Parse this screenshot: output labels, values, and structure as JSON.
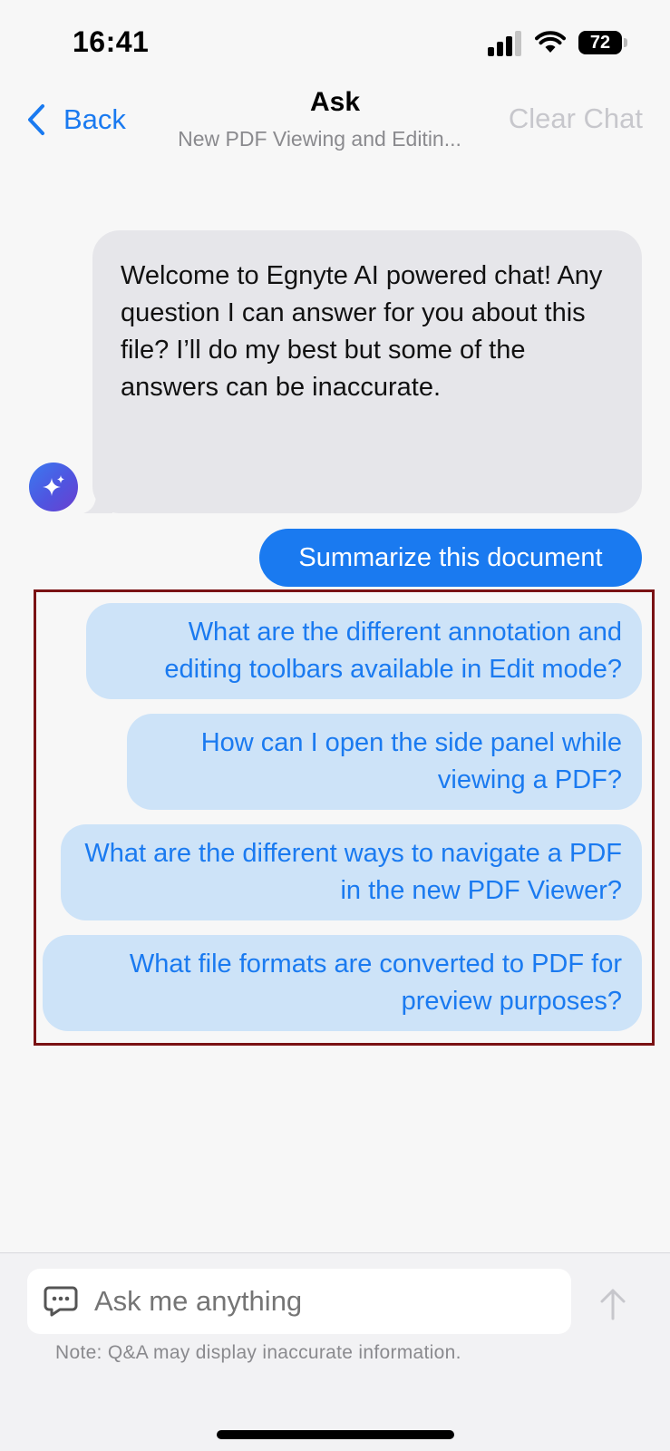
{
  "status_bar": {
    "time": "16:41",
    "battery": "72",
    "icons": [
      "cellular-signal-icon",
      "wifi-icon",
      "battery-icon"
    ]
  },
  "nav": {
    "back_label": "Back",
    "title": "Ask",
    "subtitle": "New PDF Viewing and Editin...",
    "clear_label": "Clear Chat"
  },
  "chat": {
    "bot_message": "Welcome to Egnyte AI powered chat! Any question I can answer for you about this file? I’ll do my best but some of the answers can be inaccurate.",
    "user_message": "Summarize this document",
    "suggestions": [
      "What are the different annotation and editing toolbars available in Edit mode?",
      "How can I open the side panel while viewing a PDF?",
      "What are the different ways to navigate a PDF in the new PDF Viewer?",
      "What file formats are converted to PDF for preview purposes?"
    ]
  },
  "input": {
    "placeholder": "Ask me anything",
    "note": "Note: Q&A may display inaccurate information."
  },
  "colors": {
    "accent": "#1a7af0",
    "suggestion_bg": "#cde3f8",
    "bot_bubble_bg": "#e6e6ea",
    "highlight_frame": "#7a1214"
  }
}
